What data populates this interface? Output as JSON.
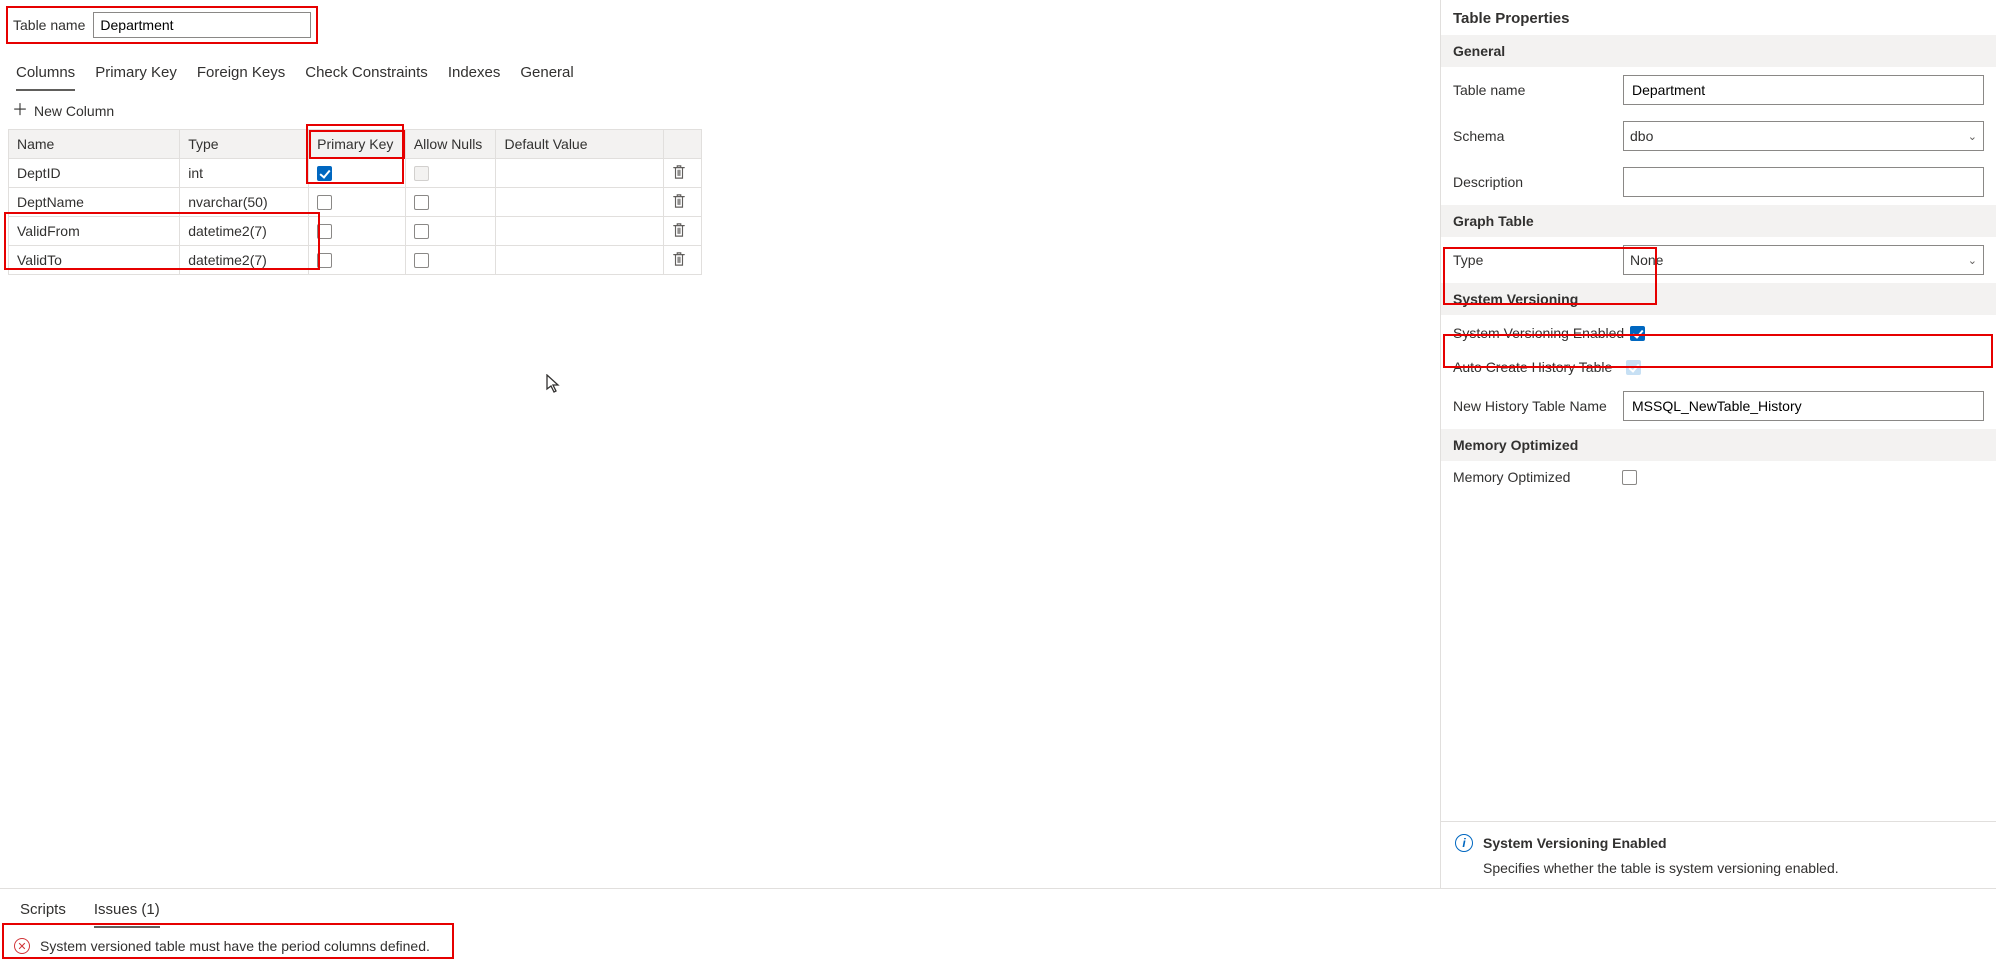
{
  "header": {
    "tableNameLabel": "Table name",
    "tableNameValue": "Department"
  },
  "tabs": {
    "columns": "Columns",
    "primaryKey": "Primary Key",
    "foreignKeys": "Foreign Keys",
    "checkConstraints": "Check Constraints",
    "indexes": "Indexes",
    "general": "General",
    "active": "columns"
  },
  "grid": {
    "newColumn": "New Column",
    "headers": {
      "name": "Name",
      "type": "Type",
      "primaryKey": "Primary Key",
      "allowNulls": "Allow Nulls",
      "defaultValue": "Default Value"
    },
    "rows": [
      {
        "name": "DeptID",
        "type": "int",
        "pk": true,
        "allowNulls": false,
        "allowNullsDisabled": true,
        "defaultValue": ""
      },
      {
        "name": "DeptName",
        "type": "nvarchar(50)",
        "pk": false,
        "allowNulls": false,
        "allowNullsDisabled": false,
        "defaultValue": ""
      },
      {
        "name": "ValidFrom",
        "type": "datetime2(7)",
        "pk": false,
        "allowNulls": false,
        "allowNullsDisabled": false,
        "defaultValue": ""
      },
      {
        "name": "ValidTo",
        "type": "datetime2(7)",
        "pk": false,
        "allowNulls": false,
        "allowNullsDisabled": false,
        "defaultValue": ""
      }
    ]
  },
  "properties": {
    "title": "Table Properties",
    "general": {
      "header": "General",
      "tableNameLabel": "Table name",
      "tableNameValue": "Department",
      "schemaLabel": "Schema",
      "schemaValue": "dbo",
      "descriptionLabel": "Description",
      "descriptionValue": ""
    },
    "graph": {
      "header": "Graph Table",
      "typeLabel": "Type",
      "typeValue": "None"
    },
    "systemVersioning": {
      "header": "System Versioning",
      "enabledLabel": "System Versioning Enabled",
      "enabled": true,
      "autoCreateLabel": "Auto Create History Table",
      "autoCreate": true,
      "autoCreateDisabled": true,
      "newHistoryLabel": "New History Table Name",
      "newHistoryValue": "MSSQL_NewTable_History"
    },
    "memory": {
      "header": "Memory Optimized",
      "label": "Memory Optimized",
      "value": false
    },
    "info": {
      "title": "System Versioning Enabled",
      "body": "Specifies whether the table is system versioning enabled."
    }
  },
  "bottom": {
    "scripts": "Scripts",
    "issues": "Issues (1)",
    "activeTab": "issues",
    "issueText": "System versioned table must have the period columns defined."
  }
}
